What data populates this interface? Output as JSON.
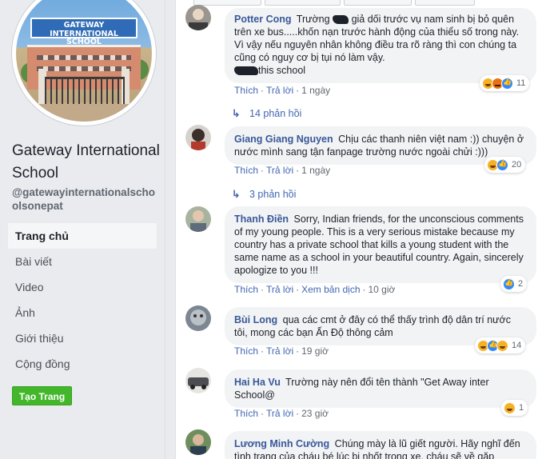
{
  "sidebar": {
    "logo_text_top": "GATEWAY",
    "logo_text_bottom": "INTERNATIONAL SCHOOL",
    "page_name": "Gateway International School",
    "handle": "@gatewayinternationalschoolsonepat",
    "nav": [
      "Trang chủ",
      "Bài viết",
      "Video",
      "Ảnh",
      "Giới thiệu",
      "Cộng đồng"
    ],
    "create_page": "Tạo Trang"
  },
  "actions_labels": {
    "like": "Thích",
    "reply": "Trả lời",
    "translate": "Xem bản dịch",
    "sep": "·"
  },
  "comments": [
    {
      "author": "Potter Cong",
      "text_a": "Trường",
      "text_b": "giả dối trước vụ nam sinh bị bỏ quên trên xe bus.....khốn nạn trước hành động của thiểu số trong này. Vì vậy nếu nguyên nhân không điều tra rõ ràng thì con chúng ta cũng có nguy cơ bị tụi nó làm vậy.",
      "text_c": "this school",
      "time": "1 ngày",
      "reactions": 11,
      "replies": "14 phản hồi"
    },
    {
      "author": "Giang Giang Nguyen",
      "text": "Chịu các thanh niên việt nam :)) chuyện ở nước mình sang tận fanpage trường nước ngoài chửi :)))",
      "time": "1 ngày",
      "reactions": 20,
      "replies": "3 phản hồi"
    },
    {
      "author": "Thanh Điền",
      "text": "Sorry, Indian friends, for the unconscious comments of my young people. This is a very serious mistake because my country has a private school that kills a young student with the same name as a school in your beautiful country. Again, sincerely apologize to you !!!",
      "time": "10 giờ",
      "reactions": 2
    },
    {
      "author": "Bùi Long",
      "text": "qua các cmt ở đây có thể thấy trình độ dân trí nước tôi, mong các bạn Ấn Độ thông cảm",
      "time": "19 giờ",
      "reactions": 14
    },
    {
      "author": "Hai Ha Vu",
      "text": "Trường này nên đổi tên thành \"Get Away inter School@",
      "time": "23 giờ",
      "reactions": 1
    },
    {
      "author": "Lương Minh Cường",
      "text": "Chúng mày là lũ giết người. Hãy nghĩ đến tình trạng của cháu bé lúc bị nhốt trong xe, cháu sẽ về gặp"
    }
  ],
  "colors": {
    "link": "#385898",
    "bubble": "#f2f3f5",
    "green": "#42b72a"
  }
}
